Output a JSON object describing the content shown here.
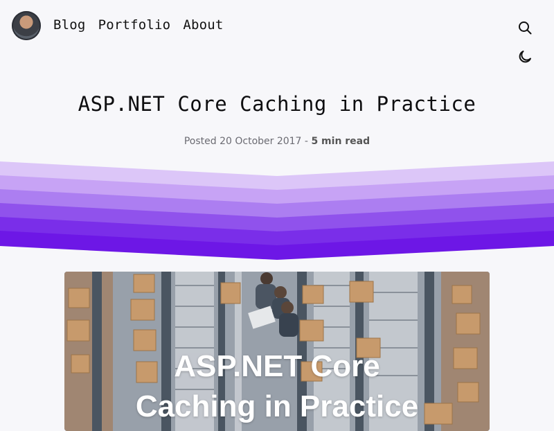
{
  "nav": {
    "links": [
      "Blog",
      "Portfolio",
      "About"
    ]
  },
  "icons": {
    "search": "search-icon",
    "theme": "moon-icon"
  },
  "post": {
    "title": "ASP.NET Core Caching in Practice",
    "posted_label": "Posted",
    "date": "20 October 2017",
    "separator": "-",
    "read_time": "5 min read"
  },
  "hero": {
    "overlay_line1": "ASP.NET Core",
    "overlay_line2": "Caching in Practice"
  },
  "colors": {
    "wave_light": "#dcc6f8",
    "wave_dark": "#6d17e6"
  }
}
